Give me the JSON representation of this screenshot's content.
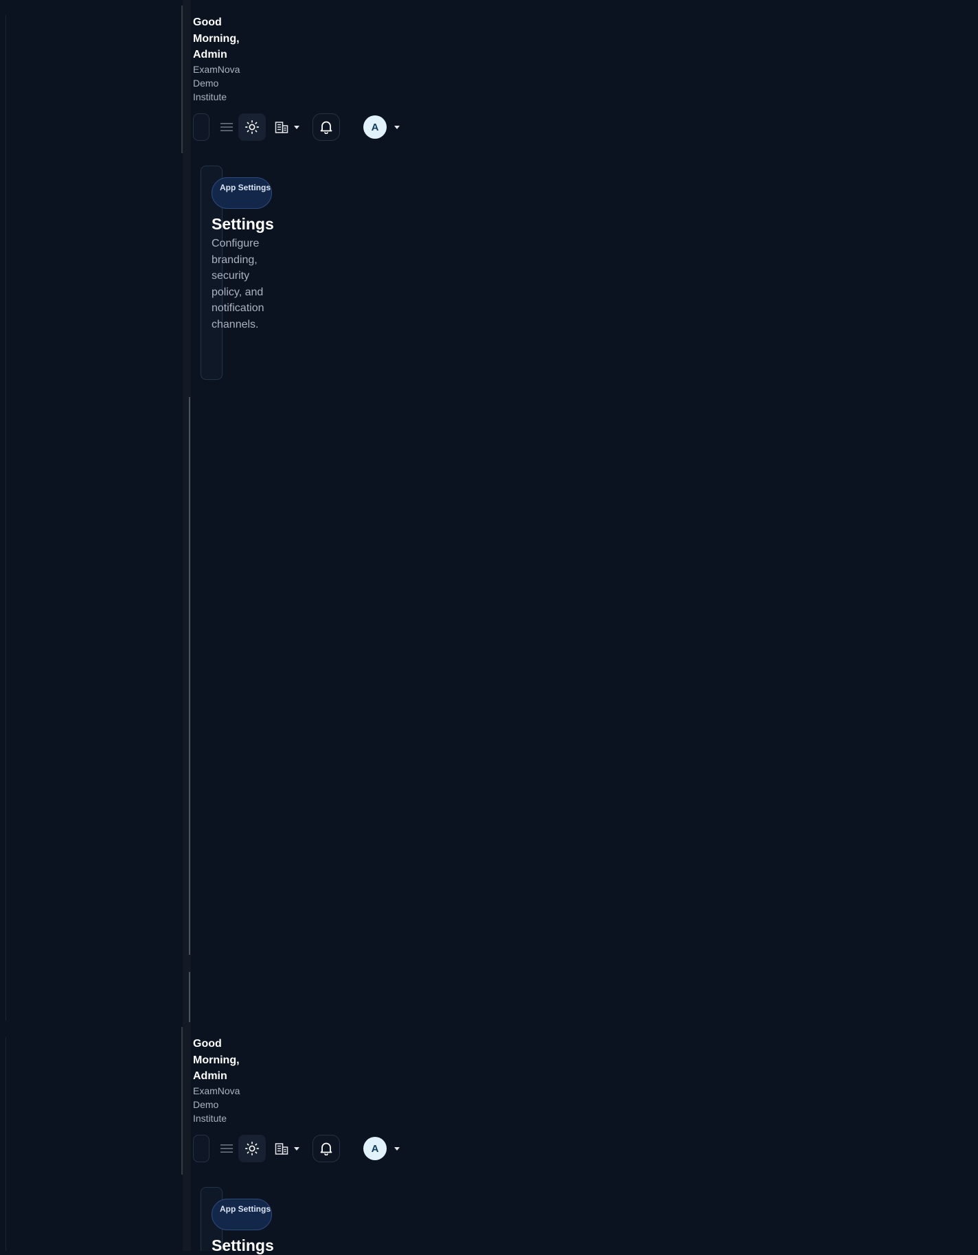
{
  "header": {
    "greeting": "Good Morning, Admin",
    "institute": "ExamNova Demo Institute",
    "avatar_initial": "A"
  },
  "icons": {
    "menu": "menu-icon",
    "theme": "sun-icon",
    "institution": "building-icon",
    "notifications": "bell-icon",
    "caret": "chevron-down-icon"
  },
  "page": {
    "badge": "App Settings",
    "title": "Settings",
    "description": "Configure branding, security policy, and notification channels."
  },
  "colors": {
    "background": "#0b1220",
    "accent_pill": "#13274a",
    "avatar_bg": "#e1f2fb"
  }
}
